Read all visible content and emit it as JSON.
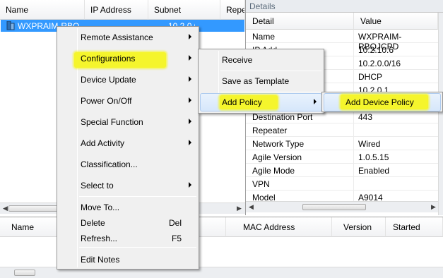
{
  "device_list": {
    "columns": [
      "Name",
      "IP Address",
      "Subnet",
      "Repe"
    ],
    "selected_row": {
      "name": "WXPRAIM-RBQJ...",
      "ip": "10.2.10.6",
      "subnet": "10.2.0.0/16"
    }
  },
  "details": {
    "title": "Details",
    "columns": [
      "Detail",
      "Value"
    ],
    "rows": [
      {
        "k": "Name",
        "v": "WXPRAIM-RBQJCPD"
      },
      {
        "k": "IP Add...",
        "v": "10.2.10.6"
      },
      {
        "k": "",
        "v": "10.2.0.0/16"
      },
      {
        "k": "",
        "v": "DHCP"
      },
      {
        "k": "",
        "v": "10.2.0.1"
      },
      {
        "k": "Destination Port",
        "v": "443"
      },
      {
        "k": "Repeater",
        "v": ""
      },
      {
        "k": "Network Type",
        "v": "Wired"
      },
      {
        "k": "Agile Version",
        "v": "1.0.5.15"
      },
      {
        "k": "Agile Mode",
        "v": "Enabled"
      },
      {
        "k": "VPN",
        "v": ""
      },
      {
        "k": "Model",
        "v": "A9014"
      }
    ]
  },
  "bottom_list": {
    "columns": [
      "Name",
      "MAC Address",
      "Version",
      "Started"
    ]
  },
  "context_menu": {
    "items": [
      {
        "label": "Remote Assistance",
        "submenu": true
      },
      {
        "label": "Configurations",
        "submenu": true
      },
      {
        "label": "Device Update",
        "submenu": true
      },
      {
        "label": "Power On/Off",
        "submenu": true
      },
      {
        "label": "Special Function",
        "submenu": true
      },
      {
        "label": "Add Activity",
        "submenu": true
      },
      {
        "label": "Classification...",
        "submenu": false
      },
      {
        "label": "Select to",
        "submenu": true
      },
      {
        "label": "Move To...",
        "submenu": false
      },
      {
        "label": "Delete",
        "shortcut": "Del"
      },
      {
        "label": "Refresh...",
        "shortcut": "F5"
      },
      {
        "label": "Edit Notes",
        "submenu": false
      }
    ]
  },
  "config_submenu": {
    "items": [
      "Receive",
      "Save as Template",
      "Add Policy"
    ]
  },
  "policy_submenu": {
    "items": [
      "Add Device Policy"
    ]
  },
  "colors": {
    "selection": "#3399ff",
    "highlight": "#f5f52c"
  }
}
